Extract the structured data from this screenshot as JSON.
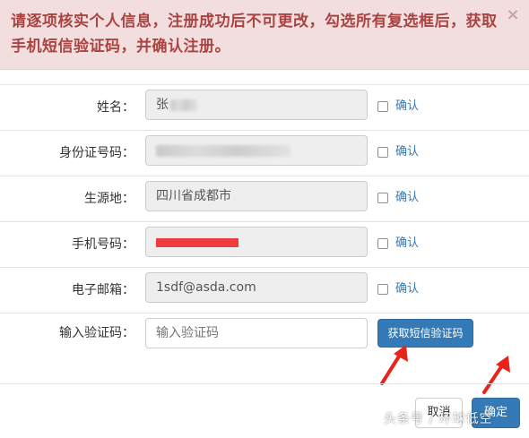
{
  "alert": {
    "message": "请逐项核实个人信息，注册成功后不可更改，勾选所有复选框后，获取手机短信验证码，并确认注册。",
    "close_symbol": "×",
    "background": "#f2dede",
    "text_color": "#a94442"
  },
  "form": {
    "rows": [
      {
        "label": "姓名：",
        "value": "张",
        "confirm_label": "确认",
        "checked": false
      },
      {
        "label": "身份证号码：",
        "value": "",
        "confirm_label": "确认",
        "checked": false
      },
      {
        "label": "生源地：",
        "value": "四川省成都市",
        "confirm_label": "确认",
        "checked": false
      },
      {
        "label": "手机号码：",
        "value": "",
        "confirm_label": "确认",
        "checked": false
      },
      {
        "label": "电子邮箱：",
        "value": "1sdf@asda.com",
        "confirm_label": "确认",
        "checked": false
      }
    ],
    "code": {
      "label": "输入验证码：",
      "placeholder": "输入验证码",
      "button_label": "获取短信验证码"
    }
  },
  "footer": {
    "cancel_label": "取消",
    "ok_label": "确定"
  },
  "annotations": {
    "arrow_color": "#e8231a"
  },
  "watermark": "头条号 / 环球低空",
  "colors": {
    "primary": "#337ab7",
    "link": "#337ab7",
    "readonly_input": "#eeeeee",
    "redaction": "#ef3c3c"
  }
}
